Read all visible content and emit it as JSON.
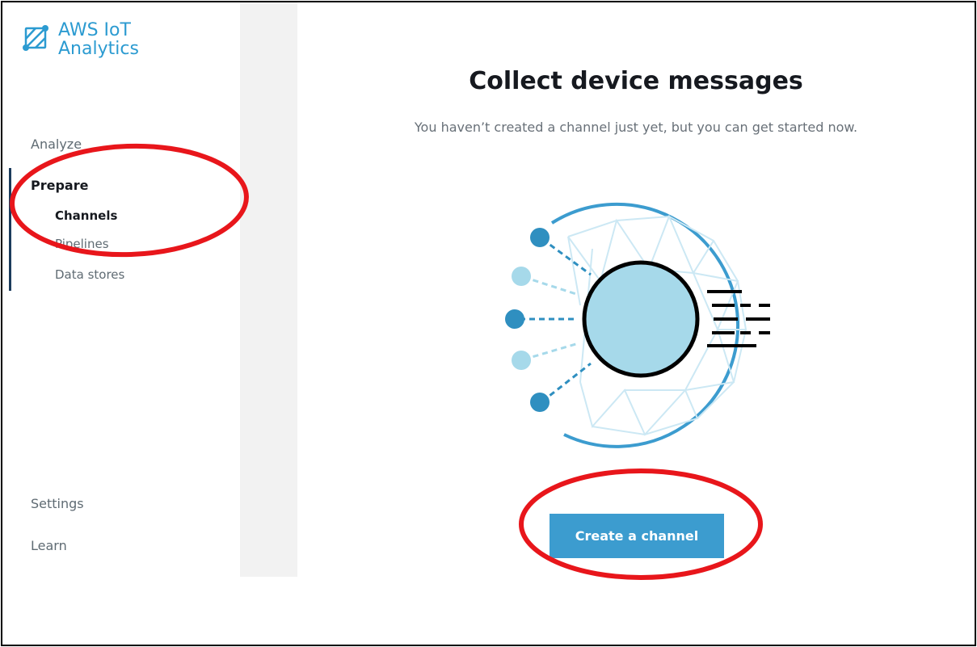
{
  "app": {
    "name_line1": "AWS IoT",
    "name_line2": "Analytics"
  },
  "sidebar": {
    "analyze": "Analyze",
    "prepare": "Prepare",
    "channels": "Channels",
    "pipelines": "Pipelines",
    "data_stores": "Data stores",
    "settings": "Settings",
    "learn": "Learn"
  },
  "main": {
    "title": "Collect device messages",
    "subtitle": "You haven’t created a channel just yet, but you can get started now.",
    "cta_label": "Create a channel"
  },
  "icons": {
    "logo": "aws-iot-analytics-logo",
    "illustration": "device-messages-channel-illustration"
  },
  "colors": {
    "brand": "#2c9bd1",
    "button": "#3c9ccf",
    "annotation": "#e8161b"
  }
}
